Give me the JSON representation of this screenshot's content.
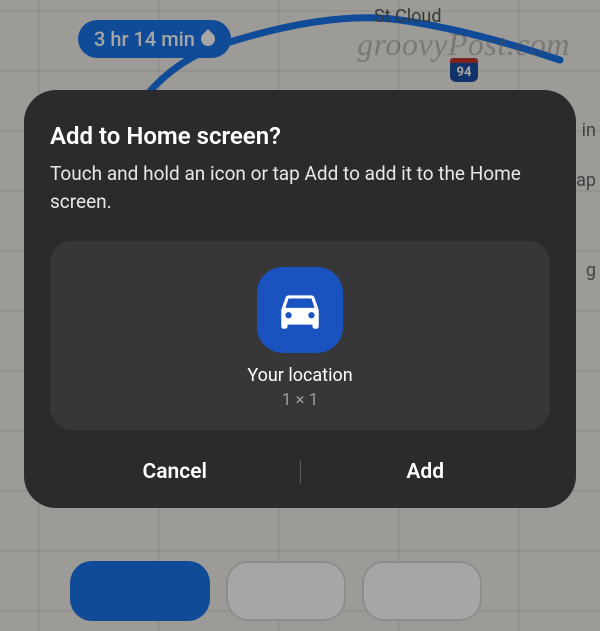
{
  "map": {
    "duration_label": "3 hr 14 min",
    "city_label": "St Cloud",
    "highway_shield": "94",
    "side_labels": {
      "in": "in",
      "ap": "ap",
      "g": "g"
    },
    "watermark": "groovyPost.com"
  },
  "dialog": {
    "title": "Add to Home screen?",
    "subtitle": "Touch and hold an icon or tap Add to add it to the Home screen.",
    "shortcut": {
      "label": "Your location",
      "size": "1 × 1",
      "icon": "car-icon"
    },
    "buttons": {
      "cancel": "Cancel",
      "add": "Add"
    }
  }
}
